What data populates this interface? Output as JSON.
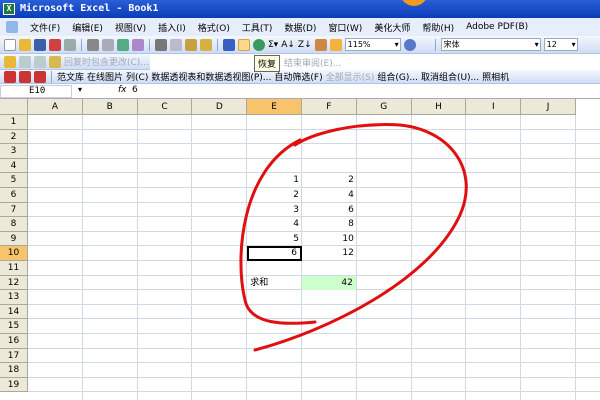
{
  "window": {
    "title": "Microsoft Excel - Book1"
  },
  "menu": [
    "文件(F)",
    "编辑(E)",
    "视图(V)",
    "插入(I)",
    "格式(O)",
    "工具(T)",
    "数据(D)",
    "窗口(W)",
    "美化大师",
    "帮助(H)",
    "Adobe PDF(B)"
  ],
  "toolbar": {
    "zoom": "115%",
    "font": "宋体",
    "font_size": "12",
    "tooltip": "恢复",
    "reply_changes": "回复时包含更改(C)...",
    "end_review": "结束审阅(E)...",
    "items": [
      "范文库",
      "在线图片",
      "列(C)",
      "数据透视表和数据透视图(P)...",
      "自动筛选(F)",
      "全部显示(S)",
      "组合(G)...",
      "取消组合(U)...",
      "照相机"
    ]
  },
  "formula_bar": {
    "name_box": "E10",
    "fx": "fx",
    "value": "6"
  },
  "columns": [
    "A",
    "B",
    "C",
    "D",
    "E",
    "F",
    "G",
    "H",
    "I",
    "J"
  ],
  "rows": [
    "1",
    "2",
    "3",
    "4",
    "5",
    "6",
    "7",
    "8",
    "9",
    "10",
    "11",
    "12",
    "13",
    "14",
    "15",
    "16",
    "17",
    "18",
    "19"
  ],
  "data": {
    "E": [
      "1",
      "2",
      "3",
      "4",
      "5",
      "6"
    ],
    "F": [
      "2",
      "4",
      "6",
      "8",
      "10",
      "12"
    ],
    "sum_label": "求和",
    "sum_value": "42"
  },
  "colors": {
    "sum_fill": "#ccffcc",
    "annotation": "#e01010",
    "selection": "#f7c46c"
  }
}
